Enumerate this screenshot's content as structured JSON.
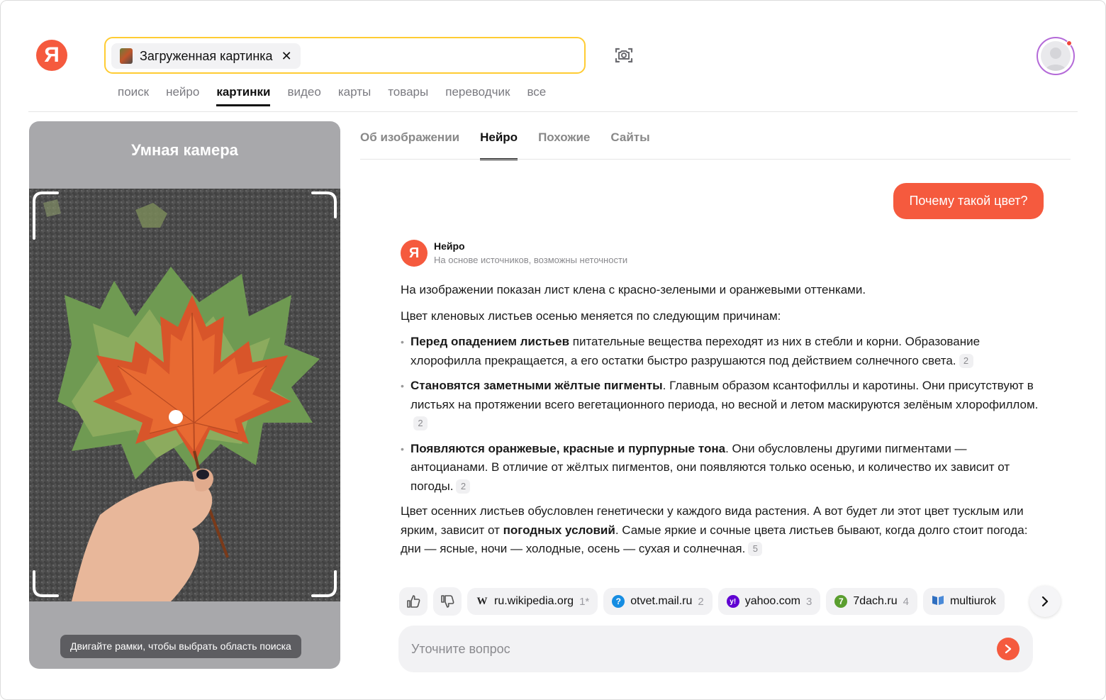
{
  "header": {
    "logo_letter": "Я",
    "search_chip_label": "Загруженная картинка",
    "search_chip_close": "✕",
    "services": [
      "поиск",
      "нейро",
      "картинки",
      "видео",
      "карты",
      "товары",
      "переводчик",
      "все"
    ],
    "active_service": "картинки"
  },
  "left_panel": {
    "title": "Умная камера",
    "hint": "Двигайте рамки, чтобы выбрать область поиска"
  },
  "tabs": [
    "Об изображении",
    "Нейро",
    "Похожие",
    "Сайты"
  ],
  "active_tab": "Нейро",
  "question": "Почему такой цвет?",
  "neuro": {
    "logo_letter": "Я",
    "name": "Нейро",
    "subtitle": "На основе источников, возможны неточности"
  },
  "answer": {
    "p1": "На изображении показан лист клена с красно-зелеными и оранжевыми оттенками.",
    "p2": "Цвет кленовых листьев осенью меняется по следующим причинам:",
    "bullets": [
      {
        "bold": "Перед опадением листьев",
        "text": " питательные вещества переходят из них в стебли и корни. Образование хлорофилла прекращается, а его остатки быстро разрушаются под действием солнечного света.",
        "cite": "2"
      },
      {
        "bold": "Становятся заметными жёлтые пигменты",
        "text": ". Главным образом ксантофиллы и каротины. Они присутствуют в листьях на протяжении всего вегетационного периода, но весной и летом маскируются зелёным хлорофиллом.",
        "cite": "2"
      },
      {
        "bold": "Появляются оранжевые, красные и пурпурные тона",
        "text": ". Они обусловлены другими пигментами — антоцианами. В отличие от жёлтых пигментов, они появляются только осенью, и количество их зависит от погоды.",
        "cite": "2"
      }
    ],
    "p3_a": "Цвет осенних листьев обусловлен генетически у каждого вида растения. А вот будет ли этот цвет тусклым или ярким, зависит от ",
    "p3_bold": "погодных условий",
    "p3_b": ". Самые яркие и сочные цвета листьев бывают, когда долго стоит погода: дни — ясные, ночи — холодные, осень — сухая и солнечная.",
    "p3_cite": "5"
  },
  "sources": [
    {
      "name": "ru.wikipedia.org",
      "count": "1*",
      "icon": "W",
      "icon_color": "#ffffff"
    },
    {
      "name": "otvet.mail.ru",
      "count": "2",
      "icon": "?",
      "icon_color": "#168de2"
    },
    {
      "name": "yahoo.com",
      "count": "3",
      "icon": "y!",
      "icon_color": "#6001d2"
    },
    {
      "name": "7dach.ru",
      "count": "4",
      "icon": "7",
      "icon_color": "#5a9e2f"
    },
    {
      "name": "multiurok",
      "count": "",
      "icon": "book",
      "icon_color": "#2f6fc0"
    }
  ],
  "input": {
    "placeholder": "Уточните вопрос"
  },
  "colors": {
    "accent": "#f55a3e",
    "search_border": "#ffcc33"
  }
}
